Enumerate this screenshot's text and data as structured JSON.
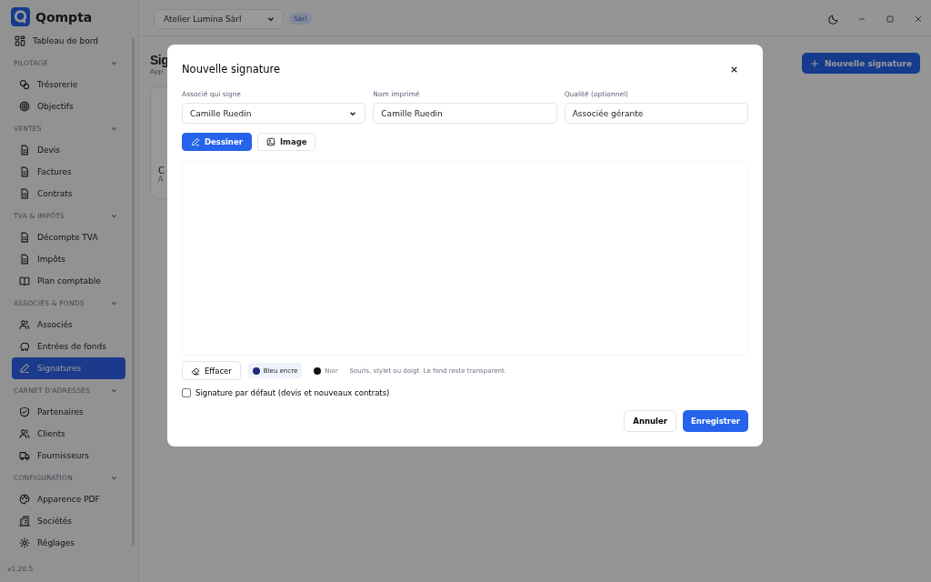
{
  "app": {
    "name": "Qompta",
    "version": "v1.20.5"
  },
  "sidebar": {
    "top_item": {
      "label": "Tableau de bord",
      "selected": false
    },
    "sections": [
      {
        "label": "PILOTAGE",
        "expanded": true,
        "items": [
          {
            "label": "Trésorerie",
            "selected": false
          },
          {
            "label": "Objectifs",
            "selected": false
          }
        ]
      },
      {
        "label": "VENTES",
        "expanded": true,
        "items": [
          {
            "label": "Devis",
            "selected": false
          },
          {
            "label": "Factures",
            "selected": false
          },
          {
            "label": "Contrats",
            "selected": false
          }
        ]
      },
      {
        "label": "TVA & IMPÔTS",
        "expanded": true,
        "items": [
          {
            "label": "Décompte TVA",
            "selected": false
          },
          {
            "label": "Impôts",
            "selected": false
          },
          {
            "label": "Plan comptable",
            "selected": false
          }
        ]
      },
      {
        "label": "ASSOCIÉS & FONDS",
        "expanded": true,
        "items": [
          {
            "label": "Associés",
            "selected": false
          },
          {
            "label": "Entrées de fonds",
            "selected": false
          },
          {
            "label": "Signatures",
            "selected": true
          }
        ]
      },
      {
        "label": "CARNET D'ADRESSES",
        "expanded": true,
        "items": [
          {
            "label": "Partenaires",
            "selected": false
          },
          {
            "label": "Clients",
            "selected": false
          },
          {
            "label": "Fournisseurs",
            "selected": false
          }
        ]
      },
      {
        "label": "CONFIGURATION",
        "expanded": true,
        "items": [
          {
            "label": "Apparence PDF",
            "selected": false
          },
          {
            "label": "Sociétés",
            "selected": false
          },
          {
            "label": "Réglages",
            "selected": false
          }
        ]
      }
    ]
  },
  "topbar": {
    "company": "Atelier Lumina Sàrl",
    "company_type": "Sàrl"
  },
  "page": {
    "title": "Sig",
    "subtitle": "App",
    "new_button": "Nouvelle signature",
    "card": {
      "line_1": "C",
      "line_2": "A"
    }
  },
  "dialog": {
    "title": "Nouvelle signature",
    "fields": [
      {
        "kind": "select",
        "label": "Associé qui signe",
        "value": "Camille Ruedin"
      },
      {
        "kind": "text",
        "label": "Nom imprimé",
        "value": "Camille Ruedin"
      },
      {
        "kind": "text",
        "label": "Qualité (optionnel)",
        "value": "Associée gérante"
      }
    ],
    "modes": [
      {
        "label": "Dessiner",
        "selected": true
      },
      {
        "label": "Image",
        "selected": false
      }
    ],
    "clear_button": "Effacer",
    "colors": [
      {
        "label": "Bleu encre",
        "color": "#1e2a78",
        "selected": true
      },
      {
        "label": "Noir",
        "color": "#111111",
        "selected": false
      }
    ],
    "hint": "Souris, stylet ou doigt. Le fond reste transparent.",
    "default_checkbox": {
      "label": "Signature par défaut (devis et nouveaux contrats)",
      "checked": false
    },
    "buttons": {
      "cancel": "Annuler",
      "save": "Enregistrer"
    }
  }
}
